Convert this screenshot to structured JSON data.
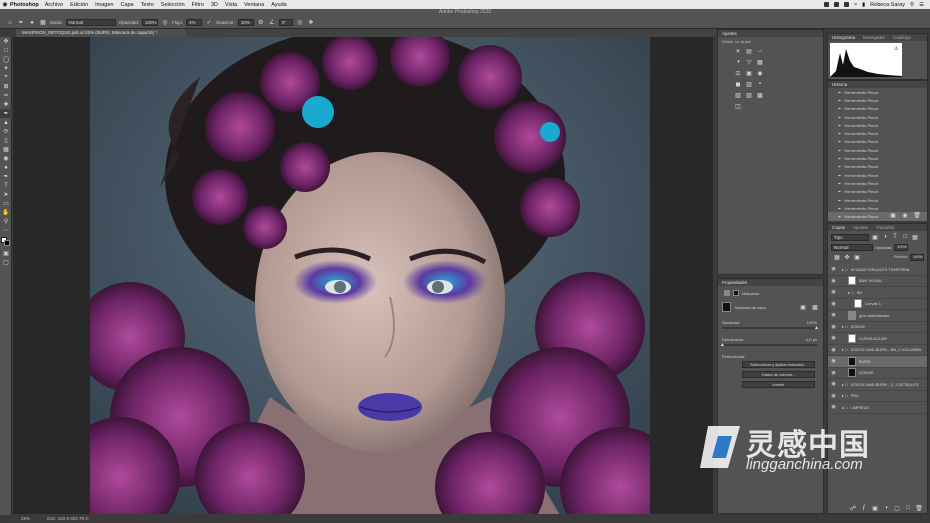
{
  "menubar": {
    "app": "Photoshop",
    "items": [
      "Archivo",
      "Edición",
      "Imagen",
      "Capa",
      "Texto",
      "Selección",
      "Filtro",
      "3D",
      "Vista",
      "Ventana",
      "Ayuda"
    ],
    "user": "Rebeca Saray"
  },
  "window_title": "Adobe Photoshop 2020",
  "options": {
    "modo_label": "Modo:",
    "modo_value": "Normal",
    "opacidad_label": "Opacidad:",
    "opacidad_value": "100%",
    "flujo_label": "Flujo:",
    "flujo_value": "4%",
    "suavizar_label": "Suavizar:",
    "suavizar_value": "10%",
    "angle_value": "0°"
  },
  "document_tab": "MASPIXON_RETOQUE.psb al 25% (BURN, Máscara de capa/16) *",
  "status": {
    "zoom": "25%",
    "doc": "Doc: 182,9 M/2,78 G"
  },
  "ajustes": {
    "title": "Ajustes",
    "subtitle": "Añadir un ajuste"
  },
  "histograma": {
    "tabs": [
      "Histograma",
      "Navegador",
      "Catálogo"
    ]
  },
  "historia": {
    "title": "Historia",
    "items": [
      "Herramienta Pincel",
      "Herramienta Pincel",
      "Herramienta Pincel",
      "Herramienta Pincel",
      "Herramienta Pincel",
      "Herramienta Pincel",
      "Herramienta Pincel",
      "Herramienta Pincel",
      "Herramienta Pincel",
      "Herramienta Pincel",
      "Herramienta Pincel",
      "Herramienta Pincel",
      "Herramienta Pincel",
      "Herramienta Pincel",
      "Herramienta Pincel",
      "Herramienta Pincel"
    ]
  },
  "propiedades": {
    "title": "Propiedades",
    "subtitle": "Máscaras",
    "mask_label": "Máscara de capa",
    "densidad_label": "Densidad:",
    "densidad_value": "100%",
    "desvanecer_label": "Desvanecer:",
    "desvanecer_value": "0,0 px",
    "perfeccionar_label": "Perfeccionar:",
    "btn_seleccionar": "Seleccionar y aplicar máscara...",
    "btn_gama": "Gama de colores...",
    "btn_invertir": "Invertir"
  },
  "capas": {
    "tabs": [
      "Capas",
      "Ajustes",
      "Trazados"
    ],
    "kind_value": "Tipo",
    "blend_value": "Normal",
    "opacity_label": "Opacidad:",
    "opacity_value": "100%",
    "fill_label": "Relleno:",
    "fill_value": "100%",
    "layers": [
      {
        "name": "AYUDAS VISUALES TEMPORAL",
        "type": "group",
        "indent": 0
      },
      {
        "name": "B&N VISUAL",
        "type": "layer",
        "indent": 1,
        "thumb": "white"
      },
      {
        "name": "BN",
        "type": "group",
        "indent": 1
      },
      {
        "name": "Curvas 1",
        "type": "layer",
        "indent": 2,
        "thumb": "white"
      },
      {
        "name": "gris neutralizador",
        "type": "layer",
        "indent": 1,
        "thumb": "grey"
      },
      {
        "name": "DODGE",
        "type": "group",
        "indent": 0
      },
      {
        "name": "CURVA ACLAR",
        "type": "layer",
        "indent": 1,
        "thumb": "white"
      },
      {
        "name": "DODGE AND BURN - BN_2 VOLUMEN",
        "type": "group",
        "indent": 0
      },
      {
        "name": "BURN",
        "type": "layer",
        "indent": 1,
        "thumb": "dark",
        "selected": true
      },
      {
        "name": "DODGE",
        "type": "layer",
        "indent": 1,
        "thumb": "dark"
      },
      {
        "name": "DODGE AND BURN - 3_1 DETALLES",
        "type": "group",
        "indent": 0
      },
      {
        "name": "PIEL",
        "type": "group",
        "indent": 0
      },
      {
        "name": "LIMPIEZA",
        "type": "group",
        "indent": 0
      }
    ]
  },
  "watermark": {
    "cn": "灵感中国",
    "url": "lingganchina.com"
  }
}
